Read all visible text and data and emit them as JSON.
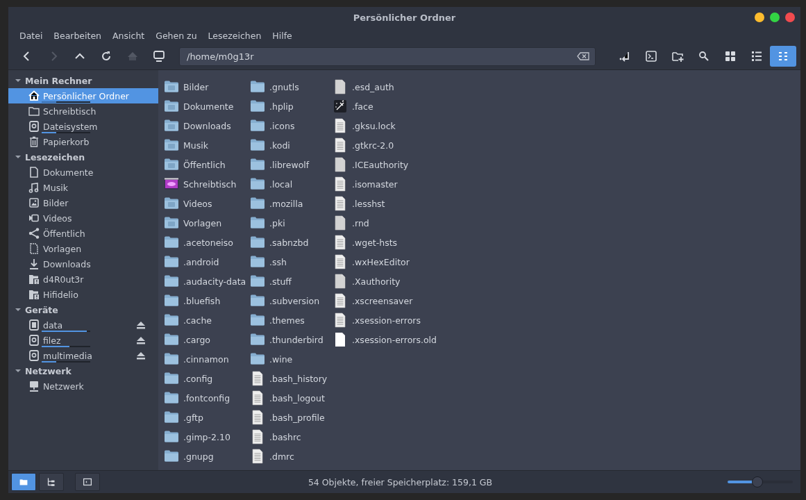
{
  "window": {
    "title": "Persönlicher Ordner",
    "controls": [
      {
        "color": "#fdbc2e"
      },
      {
        "color": "#33d444"
      },
      {
        "color": "#f14b4f"
      }
    ]
  },
  "menu": [
    "Datei",
    "Bearbeiten",
    "Ansicht",
    "Gehen zu",
    "Lesezeichen",
    "Hilfe"
  ],
  "toolbar": {
    "nav": [
      {
        "kind": "back",
        "disabled": false
      },
      {
        "kind": "forward",
        "disabled": true
      },
      {
        "kind": "up",
        "disabled": false
      },
      {
        "kind": "reload",
        "disabled": false
      },
      {
        "kind": "home",
        "disabled": true
      },
      {
        "kind": "computer",
        "disabled": false
      }
    ],
    "path": {
      "value": "/home/m0g13r"
    },
    "actions": [
      {
        "kind": "enter"
      },
      {
        "kind": "terminal"
      },
      {
        "kind": "new-folder"
      },
      {
        "kind": "search"
      }
    ],
    "views": [
      {
        "kind": "icons",
        "selected": false
      },
      {
        "kind": "list",
        "selected": false
      },
      {
        "kind": "compact",
        "selected": true
      }
    ]
  },
  "sidebar": [
    {
      "title": "Mein Rechner",
      "expanded": true,
      "items": [
        {
          "label": "Persönlicher Ordner",
          "kind": "home",
          "selected": true,
          "level": 0.3
        },
        {
          "label": "Schreibtisch",
          "kind": "folder",
          "selected": false
        },
        {
          "label": "Dateisystem",
          "kind": "drive",
          "selected": false,
          "level": 0.3
        },
        {
          "label": "Papierkorb",
          "kind": "trash",
          "selected": false
        }
      ]
    },
    {
      "title": "Lesezeichen",
      "expanded": true,
      "items": [
        {
          "label": "Dokumente",
          "kind": "document",
          "selected": false
        },
        {
          "label": "Musik",
          "kind": "music",
          "selected": false
        },
        {
          "label": "Bilder",
          "kind": "image",
          "selected": false
        },
        {
          "label": "Videos",
          "kind": "video",
          "selected": false
        },
        {
          "label": "Öffentlich",
          "kind": "share",
          "selected": false
        },
        {
          "label": "Vorlagen",
          "kind": "template",
          "selected": false
        },
        {
          "label": "Downloads",
          "kind": "download",
          "selected": false
        },
        {
          "label": "d4R0ut3r",
          "kind": "folder-warning",
          "selected": false
        },
        {
          "label": "Hifidelio",
          "kind": "folder-warning",
          "selected": false
        }
      ]
    },
    {
      "title": "Geräte",
      "expanded": true,
      "items": [
        {
          "label": "data",
          "kind": "chip",
          "selected": false,
          "level": 0.93,
          "eject": true
        },
        {
          "label": "filez",
          "kind": "drive",
          "selected": false,
          "level": 0.57,
          "eject": true
        },
        {
          "label": "multimedia",
          "kind": "drive",
          "selected": false,
          "level": 0.3,
          "eject": true
        }
      ]
    },
    {
      "title": "Netzwerk",
      "expanded": true,
      "items": [
        {
          "label": "Netzwerk",
          "kind": "network",
          "selected": false
        }
      ]
    }
  ],
  "files": [
    {
      "name": "Bilder",
      "kind": "special-folder"
    },
    {
      "name": "Dokumente",
      "kind": "special-folder"
    },
    {
      "name": "Downloads",
      "kind": "special-folder"
    },
    {
      "name": "Musik",
      "kind": "special-folder"
    },
    {
      "name": "Öffentlich",
      "kind": "special-folder"
    },
    {
      "name": "Schreibtisch",
      "kind": "desktop-folder"
    },
    {
      "name": "Videos",
      "kind": "special-folder"
    },
    {
      "name": "Vorlagen",
      "kind": "special-folder"
    },
    {
      "name": ".acetoneiso",
      "kind": "folder"
    },
    {
      "name": ".android",
      "kind": "folder"
    },
    {
      "name": ".audacity-data",
      "kind": "folder"
    },
    {
      "name": ".bluefish",
      "kind": "folder"
    },
    {
      "name": ".cache",
      "kind": "folder"
    },
    {
      "name": ".cargo",
      "kind": "folder"
    },
    {
      "name": ".cinnamon",
      "kind": "folder"
    },
    {
      "name": ".config",
      "kind": "folder"
    },
    {
      "name": ".fontconfig",
      "kind": "folder"
    },
    {
      "name": ".gftp",
      "kind": "folder"
    },
    {
      "name": ".gimp-2.10",
      "kind": "folder"
    },
    {
      "name": ".gnupg",
      "kind": "folder"
    },
    {
      "name": ".gnutls",
      "kind": "folder"
    },
    {
      "name": ".hplip",
      "kind": "folder"
    },
    {
      "name": ".icons",
      "kind": "folder"
    },
    {
      "name": ".kodi",
      "kind": "folder"
    },
    {
      "name": ".librewolf",
      "kind": "folder"
    },
    {
      "name": ".local",
      "kind": "folder"
    },
    {
      "name": ".mozilla",
      "kind": "folder"
    },
    {
      "name": ".pki",
      "kind": "folder"
    },
    {
      "name": ".sabnzbd",
      "kind": "folder"
    },
    {
      "name": ".ssh",
      "kind": "folder"
    },
    {
      "name": ".stuff",
      "kind": "folder"
    },
    {
      "name": ".subversion",
      "kind": "folder"
    },
    {
      "name": ".themes",
      "kind": "folder"
    },
    {
      "name": ".thunderbird",
      "kind": "folder"
    },
    {
      "name": ".wine",
      "kind": "folder"
    },
    {
      "name": ".bash_history",
      "kind": "text-file"
    },
    {
      "name": ".bash_logout",
      "kind": "text-file"
    },
    {
      "name": ".bash_profile",
      "kind": "text-file"
    },
    {
      "name": ".bashrc",
      "kind": "text-file"
    },
    {
      "name": ".dmrc",
      "kind": "text-file"
    },
    {
      "name": ".esd_auth",
      "kind": "binary-file"
    },
    {
      "name": ".face",
      "kind": "image-file"
    },
    {
      "name": ".gksu.lock",
      "kind": "text-file"
    },
    {
      "name": ".gtkrc-2.0",
      "kind": "text-file"
    },
    {
      "name": ".ICEauthority",
      "kind": "binary-file"
    },
    {
      "name": ".isomaster",
      "kind": "text-file"
    },
    {
      "name": ".lesshst",
      "kind": "text-file"
    },
    {
      "name": ".rnd",
      "kind": "binary-file"
    },
    {
      "name": ".wget-hsts",
      "kind": "text-file"
    },
    {
      "name": ".wxHexEditor",
      "kind": "text-file"
    },
    {
      "name": ".Xauthority",
      "kind": "binary-file"
    },
    {
      "name": ".xscreensaver",
      "kind": "text-file"
    },
    {
      "name": ".xsession-errors",
      "kind": "text-file"
    },
    {
      "name": ".xsession-errors.old",
      "kind": "empty-file"
    }
  ],
  "status_bar": {
    "buttons": [
      {
        "kind": "places",
        "selected": true
      },
      {
        "kind": "tree",
        "selected": false
      },
      {
        "kind": "toggle-sidebar",
        "selected": false
      }
    ],
    "text": "54 Objekte, freier Speicherplatz: 159,1 GB",
    "zoom": {
      "level": 0.45
    }
  }
}
